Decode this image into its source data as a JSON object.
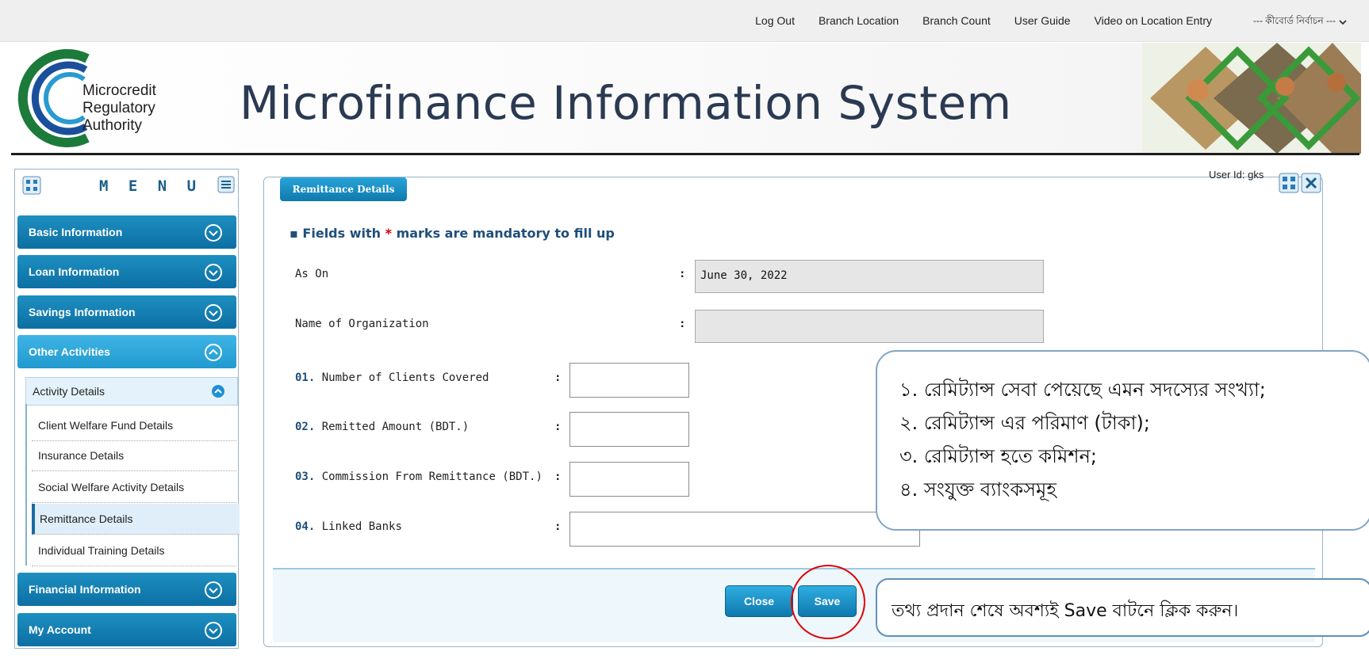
{
  "top_nav": {
    "links": [
      "Log Out",
      "Branch Location",
      "Branch Count",
      "User Guide",
      "Video on Location Entry"
    ],
    "language_select": "--- কীবোর্ড নির্বাচন ---"
  },
  "header": {
    "logo_text": [
      "Microcredit",
      "Regulatory",
      "Authority"
    ],
    "title": "Microfinance Information System"
  },
  "sidebar": {
    "title": "M E N U",
    "sections": [
      {
        "label": "Basic Information",
        "state": "collapsed"
      },
      {
        "label": "Loan Information",
        "state": "collapsed"
      },
      {
        "label": "Savings Information",
        "state": "collapsed"
      },
      {
        "label": "Other Activities",
        "state": "expanded"
      },
      {
        "label": "Financial Information",
        "state": "collapsed"
      },
      {
        "label": "My Account",
        "state": "collapsed"
      }
    ],
    "subgroup": "Activity Details",
    "subitems": [
      "Client Welfare Fund Details",
      "Insurance Details",
      "Social Welfare Activity Details",
      "Remittance Details",
      "Individual Training Details"
    ],
    "active_subitem": "Remittance Details"
  },
  "panel": {
    "tab_title": "Remittance Details",
    "user_id": "User Id: gks",
    "mandatory_note": "Fields with",
    "mandatory_star": "*",
    "mandatory_tail": "marks are mandatory to fill up",
    "fields": {
      "as_on": {
        "label": "As On",
        "value": "June 30, 2022"
      },
      "org": {
        "label": "Name of Organization",
        "value": ""
      },
      "f1": {
        "num": "01.",
        "label": "Number of Clients Covered",
        "value": ""
      },
      "f2": {
        "num": "02.",
        "label": "Remitted Amount (BDT.)",
        "value": ""
      },
      "f3": {
        "num": "03.",
        "label": "Commission From Remittance (BDT.)",
        "value": ""
      },
      "f4": {
        "num": "04.",
        "label": "Linked Banks",
        "value": ""
      }
    },
    "colon": ":",
    "buttons": {
      "close": "Close",
      "save": "Save"
    }
  },
  "callouts": {
    "fields_help": [
      "১. রেমিট্যান্স সেবা পেয়েছে এমন সদস্যের সংখ্যা;",
      "২. রেমিট্যান্স এর পরিমাণ (টাকা);",
      "৩. রেমিট্যান্স হতে কমিশন;",
      "৪. সংযুক্ত ব্যাংকসমূহ"
    ],
    "save_help": "তথ্য প্রদান শেষে অবশ্যই Save বাটনে ক্লিক করুন।"
  },
  "colors": {
    "accent": "#0f79ad",
    "brand_text": "#2b3a52",
    "highlight_ring": "#e00000"
  }
}
